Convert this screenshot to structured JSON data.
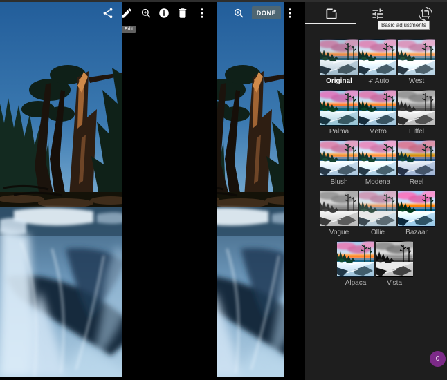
{
  "viewer_toolbar": {
    "icons": [
      "share-icon",
      "edit-icon",
      "zoom-in-icon",
      "info-icon",
      "delete-icon",
      "more-options-icon"
    ],
    "edit_tooltip": "Edit"
  },
  "editor_toolbar": {
    "icons": [
      "zoom-in-icon",
      "more-options-icon"
    ],
    "done_label": "DONE"
  },
  "filters_panel": {
    "tabs": [
      {
        "name": "filters",
        "icon": "photo-filter-icon",
        "selected": true
      },
      {
        "name": "basic-adjustments",
        "icon": "tune-icon",
        "selected": false
      },
      {
        "name": "crop-rotate",
        "icon": "crop-rotate-icon",
        "selected": false
      }
    ],
    "adjustments_tooltip": "Basic adjustments",
    "filters": [
      {
        "label": "Original",
        "variant": "original",
        "selected": true
      },
      {
        "label": "Auto",
        "variant": "auto",
        "icon": "auto-sparkle-icon",
        "selected": false
      },
      {
        "label": "West",
        "variant": "west",
        "selected": false
      },
      {
        "label": "Palma",
        "variant": "palma",
        "selected": false
      },
      {
        "label": "Metro",
        "variant": "metro",
        "selected": false
      },
      {
        "label": "Eiffel",
        "variant": "eiffel",
        "selected": false
      },
      {
        "label": "Blush",
        "variant": "blush",
        "selected": false
      },
      {
        "label": "Modena",
        "variant": "modena",
        "selected": false
      },
      {
        "label": "Reel",
        "variant": "reel",
        "selected": false
      },
      {
        "label": "Vogue",
        "variant": "vogue",
        "selected": false
      },
      {
        "label": "Ollie",
        "variant": "ollie",
        "selected": false
      },
      {
        "label": "Bazaar",
        "variant": "bazaar",
        "selected": false
      },
      {
        "label": "Alpaca",
        "variant": "alpaca",
        "selected": false
      },
      {
        "label": "Vista",
        "variant": "vista",
        "selected": false
      }
    ],
    "fab_count": "0"
  },
  "colors": {
    "done_button_bg": "#4e6673",
    "fab_bg": "#7c2a88",
    "panel_bg": "#1e1e1e",
    "tab_underline": "#ececec",
    "filter_label": "#b5b5b5",
    "selected_filter_label": "#ffffff"
  }
}
